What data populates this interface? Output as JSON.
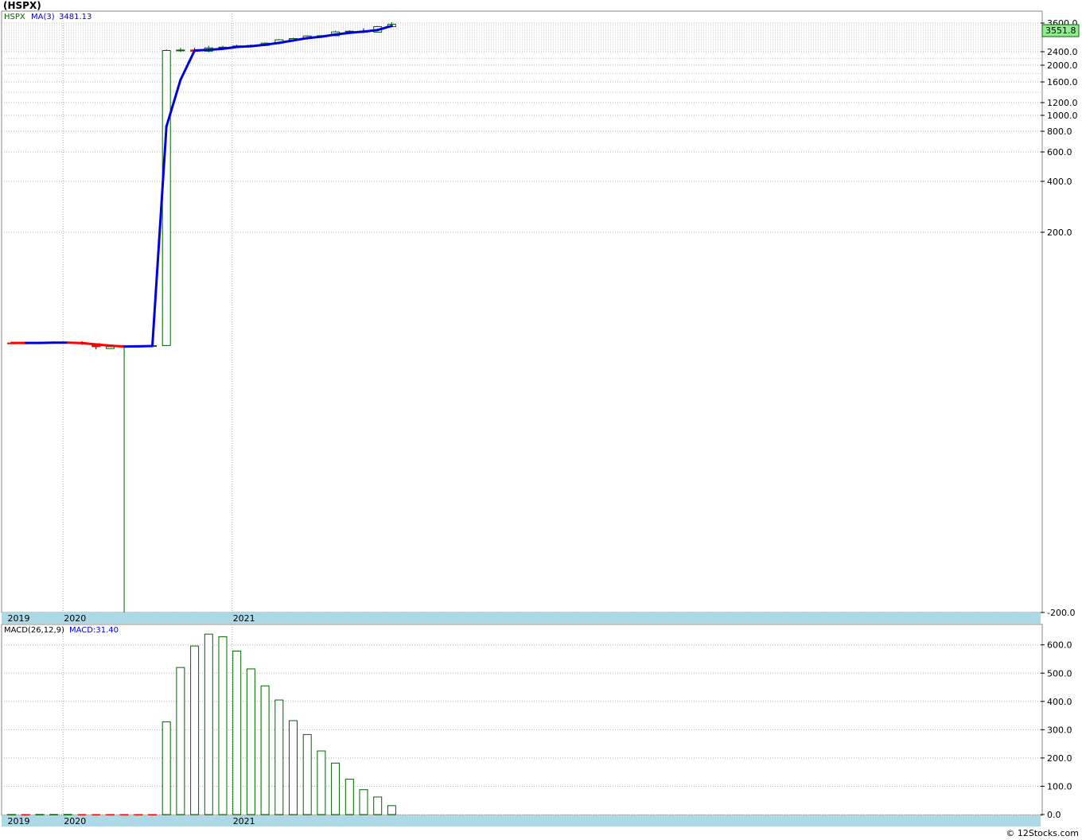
{
  "page": {
    "title": "(HSPX)",
    "footer": "© 12Stocks.com"
  },
  "colors": {
    "up": "#006400",
    "down": "#ff0000",
    "ma_rising": "#0000dd",
    "ma_falling": "#ff0000",
    "grid": "#b0b0b0",
    "axis_band": "#add8e6",
    "price_tag_bg": "#90ee90"
  },
  "chart_data": [
    {
      "type": "candlestick",
      "legend": {
        "symbol": "HSPX",
        "ma_label": "MA(3)",
        "ma_value": "3481.13"
      },
      "last_price_label": "3551.8",
      "y_ticks": [
        {
          "value": 3600,
          "label": "3600.0"
        },
        {
          "value": 2400,
          "label": "2400.0"
        },
        {
          "value": 2000,
          "label": "2000.0"
        },
        {
          "value": 1600,
          "label": "1600.0"
        },
        {
          "value": 1200,
          "label": "1200.0"
        },
        {
          "value": 1000,
          "label": "1000.0"
        },
        {
          "value": 800,
          "label": "800.0"
        },
        {
          "value": 600,
          "label": "600.0"
        },
        {
          "value": 400,
          "label": "400.0"
        },
        {
          "value": 200,
          "label": "200.0"
        },
        {
          "value": -200,
          "label": "-200.0"
        }
      ],
      "x_labels": [
        {
          "label": "2019",
          "month_index": 0
        },
        {
          "label": "2020",
          "month_index": 4
        },
        {
          "label": "2021",
          "month_index": 16
        }
      ],
      "candles": [
        {
          "o": 28.0,
          "h": 28.6,
          "l": 27.3,
          "c": 27.8
        },
        {
          "o": 27.8,
          "h": 29.0,
          "l": 27.0,
          "c": 28.1
        },
        {
          "o": 28.1,
          "h": 29.0,
          "l": 27.5,
          "c": 28.5
        },
        {
          "o": 28.5,
          "h": 29.3,
          "l": 28.0,
          "c": 28.8
        },
        {
          "o": 28.8,
          "h": 29.3,
          "l": 27.8,
          "c": 28.2
        },
        {
          "o": 28.5,
          "h": 30.8,
          "l": 25.2,
          "c": 26.8
        },
        {
          "o": 26.8,
          "h": 27.5,
          "l": 20.0,
          "c": 22.2
        },
        {
          "o": 20.6,
          "h": 22.6,
          "l": 20.3,
          "c": 22.3
        },
        {
          "o": 22.3,
          "h": 23.0,
          "l": -200,
          "c": 22.8
        },
        {
          "o": 22.8,
          "h": 24.5,
          "l": 22.3,
          "c": 23.0
        },
        {
          "o": 23.0,
          "h": 24.2,
          "l": 22.6,
          "c": 23.8
        },
        {
          "o": 24.0,
          "h": 2500,
          "l": 23.5,
          "c": 2450
        },
        {
          "o": 2450,
          "h": 2560,
          "l": 2390,
          "c": 2470
        },
        {
          "o": 2470,
          "h": 2560,
          "l": 2380,
          "c": 2420
        },
        {
          "o": 2420,
          "h": 2650,
          "l": 2380,
          "c": 2560
        },
        {
          "o": 2560,
          "h": 2650,
          "l": 2490,
          "c": 2590
        },
        {
          "o": 2590,
          "h": 2700,
          "l": 2550,
          "c": 2640
        },
        {
          "o": 2640,
          "h": 2700,
          "l": 2600,
          "c": 2660
        },
        {
          "o": 2660,
          "h": 2790,
          "l": 2640,
          "c": 2760
        },
        {
          "o": 2760,
          "h": 2930,
          "l": 2740,
          "c": 2900
        },
        {
          "o": 2900,
          "h": 2980,
          "l": 2860,
          "c": 2950
        },
        {
          "o": 2950,
          "h": 3080,
          "l": 2900,
          "c": 3060
        },
        {
          "o": 3060,
          "h": 3100,
          "l": 2980,
          "c": 3070
        },
        {
          "o": 3070,
          "h": 3280,
          "l": 3050,
          "c": 3230
        },
        {
          "o": 3230,
          "h": 3300,
          "l": 3190,
          "c": 3260
        },
        {
          "o": 3260,
          "h": 3380,
          "l": 3180,
          "c": 3220
        },
        {
          "o": 3220,
          "h": 3480,
          "l": 3200,
          "c": 3450
        },
        {
          "o": 3450,
          "h": 3640,
          "l": 3420,
          "c": 3552
        }
      ],
      "ma3": [
        28.0,
        27.95,
        28.1,
        28.5,
        28.5,
        27.9,
        25.7,
        23.8,
        22.4,
        22.7,
        23.2,
        860,
        1650,
        2450,
        2480,
        2520,
        2600,
        2630,
        2690,
        2770,
        2870,
        2970,
        3030,
        3120,
        3190,
        3240,
        3310,
        3481.13
      ]
    },
    {
      "type": "bar",
      "legend": {
        "label": "MACD(26,12,9)",
        "value_label": "MACD:31.40"
      },
      "y_ticks": [
        {
          "value": 600,
          "label": "600.0"
        },
        {
          "value": 500,
          "label": "500.0"
        },
        {
          "value": 400,
          "label": "400.0"
        },
        {
          "value": 300,
          "label": "300.0"
        },
        {
          "value": 200,
          "label": "200.0"
        },
        {
          "value": 100,
          "label": "100.0"
        },
        {
          "value": 0,
          "label": "0.0"
        }
      ],
      "x_labels": [
        {
          "label": "2019",
          "month_index": 0
        },
        {
          "label": "2020",
          "month_index": 4
        },
        {
          "label": "2021",
          "month_index": 16
        }
      ],
      "values": [
        0.1,
        -0.2,
        0.3,
        0.2,
        0.4,
        -0.5,
        -1.2,
        -1.5,
        -1.4,
        -1.1,
        -0.8,
        328,
        520,
        596,
        638,
        629,
        578,
        515,
        455,
        405,
        332,
        283,
        225,
        182,
        125,
        88,
        62,
        31.4
      ]
    }
  ]
}
